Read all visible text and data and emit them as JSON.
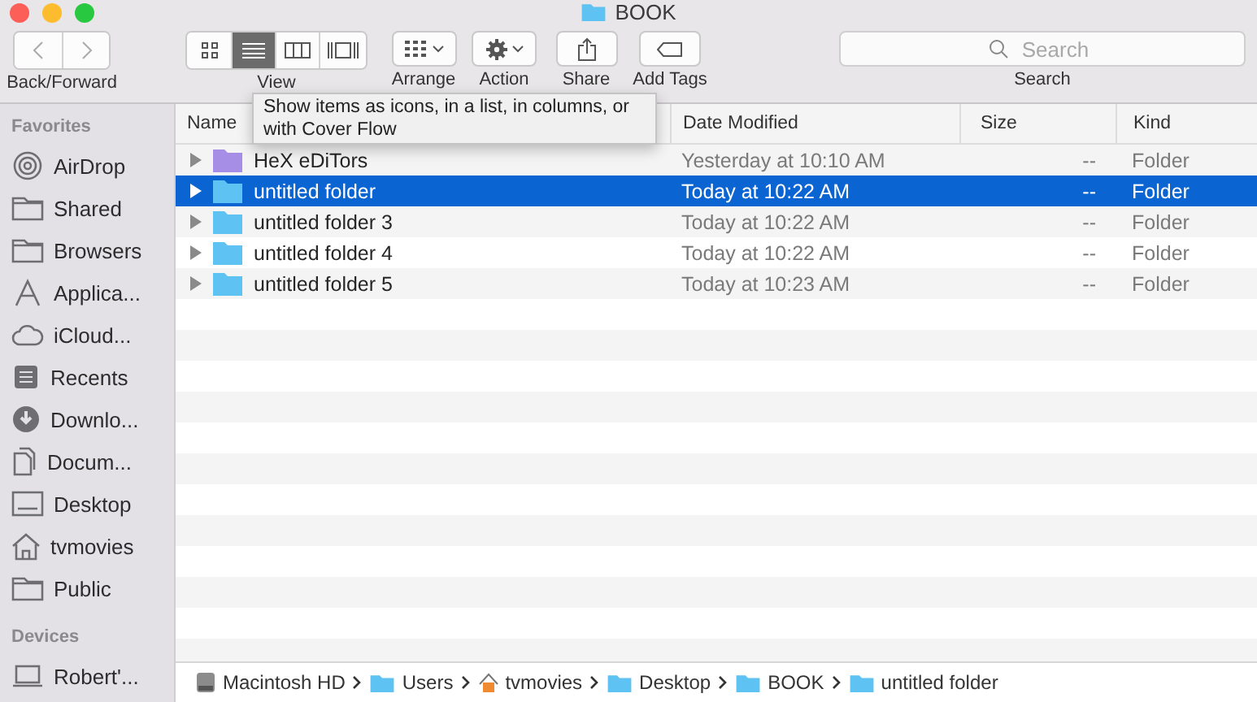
{
  "window": {
    "title": "BOOK"
  },
  "toolbar": {
    "back_forward_label": "Back/Forward",
    "view_modes": [
      {
        "selected": false
      },
      {
        "selected": true
      },
      {
        "selected": false
      },
      {
        "selected": false
      }
    ],
    "labels": [
      "View",
      "Arrange",
      "Action",
      "Share",
      "Add Tags"
    ],
    "search": {
      "placeholder": "Search",
      "label": "Search"
    }
  },
  "tooltip": "Show items as icons, in a list, in columns, or with Cover Flow",
  "sidebar": {
    "sections": [
      {
        "title": "Favorites",
        "items": [
          {
            "label": "AirDrop"
          },
          {
            "label": "Shared"
          },
          {
            "label": "Browsers"
          },
          {
            "label": "Applica..."
          },
          {
            "label": "iCloud..."
          },
          {
            "label": "Recents"
          },
          {
            "label": "Downlo..."
          },
          {
            "label": "Docum..."
          },
          {
            "label": "Desktop"
          },
          {
            "label": "tvmovies"
          },
          {
            "label": "Public"
          }
        ]
      },
      {
        "title": "Devices",
        "items": [
          {
            "label": "Robert'..."
          }
        ]
      }
    ]
  },
  "table": {
    "columns": [
      "Name",
      "Date Modified",
      "Size",
      "Kind"
    ],
    "rows": [
      {
        "name": "HeX eDiTors",
        "date": "Yesterday at 10:10 AM",
        "size": "--",
        "kind": "Folder",
        "selected": false,
        "color": "#a68ee6"
      },
      {
        "name": "untitled folder",
        "date": "Today at 10:22 AM",
        "size": "--",
        "kind": "Folder",
        "selected": true,
        "color": "#5ec2f2"
      },
      {
        "name": "untitled folder 3",
        "date": "Today at 10:22 AM",
        "size": "--",
        "kind": "Folder",
        "selected": false,
        "color": "#5ec2f2"
      },
      {
        "name": "untitled folder 4",
        "date": "Today at 10:22 AM",
        "size": "--",
        "kind": "Folder",
        "selected": false,
        "color": "#5ec2f2"
      },
      {
        "name": "untitled folder 5",
        "date": "Today at 10:23 AM",
        "size": "--",
        "kind": "Folder",
        "selected": false,
        "color": "#5ec2f2"
      }
    ]
  },
  "path_bar": [
    "Macintosh HD",
    "Users",
    "tvmovies",
    "Desktop",
    "BOOK",
    "untitled folder"
  ]
}
